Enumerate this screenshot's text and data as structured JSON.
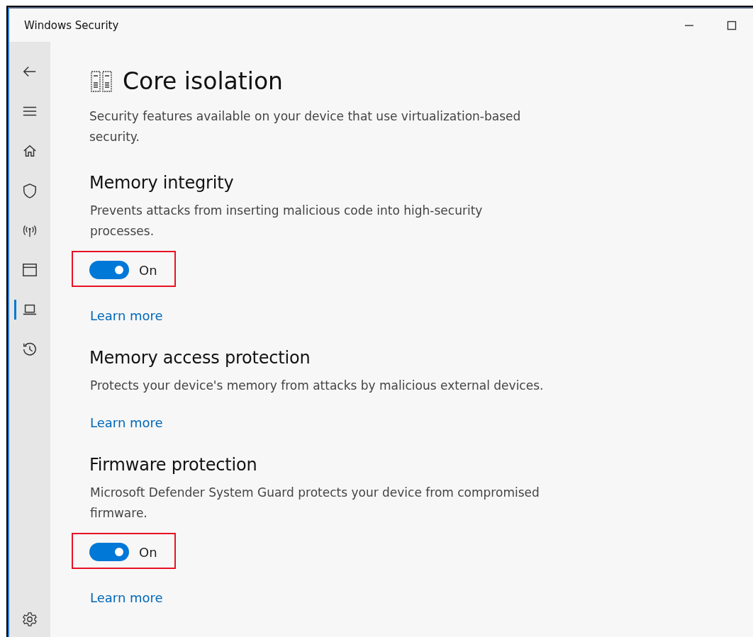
{
  "window": {
    "title": "Windows Security",
    "controls": [
      {
        "kind": "minimize"
      },
      {
        "kind": "maximize"
      }
    ]
  },
  "sidebar": {
    "items": [
      {
        "kind": "back",
        "selected": false
      },
      {
        "kind": "menu",
        "selected": false
      },
      {
        "kind": "home",
        "selected": false
      },
      {
        "kind": "shield",
        "selected": false
      },
      {
        "kind": "antenna",
        "selected": false
      },
      {
        "kind": "window",
        "selected": false
      },
      {
        "kind": "laptop",
        "selected": true
      },
      {
        "kind": "history",
        "selected": false
      }
    ],
    "footer": [
      {
        "kind": "settings",
        "selected": false
      }
    ]
  },
  "page": {
    "title": "Core isolation",
    "description": "Security features available on your device that use virtualization-based security."
  },
  "sections": [
    {
      "title": "Memory integrity",
      "description": "Prevents attacks from inserting malicious code into high-security processes.",
      "toggle": {
        "on": true,
        "label": "On",
        "highlighted": true
      },
      "link": "Learn more"
    },
    {
      "title": "Memory access protection",
      "description": "Protects your device's memory from attacks by malicious external devices.",
      "link": "Learn more"
    },
    {
      "title": "Firmware protection",
      "description": "Microsoft Defender System Guard protects your device from compromised firmware.",
      "toggle": {
        "on": true,
        "label": "On",
        "highlighted": true
      },
      "link": "Learn more"
    }
  ]
}
